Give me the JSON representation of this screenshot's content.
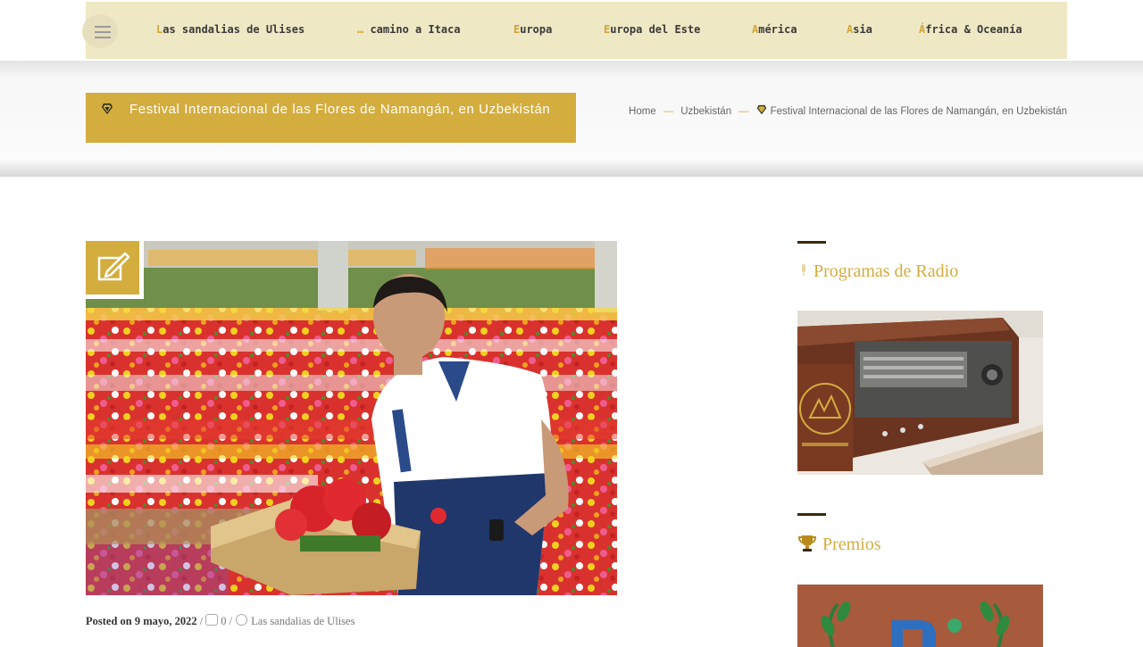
{
  "nav": {
    "items": [
      {
        "first": "L",
        "rest": "as sandalias de Ulises"
      },
      {
        "first": "…",
        "rest": " camino a Itaca"
      },
      {
        "first": "E",
        "rest": "uropa"
      },
      {
        "first": "E",
        "rest": "uropa del Este"
      },
      {
        "first": "A",
        "rest": "mérica"
      },
      {
        "first": "A",
        "rest": "sia"
      },
      {
        "first": "Á",
        "rest": "frica & Oceanía"
      }
    ]
  },
  "page_title": "Festival Internacional de las Flores de Namangán, en Uzbekistán",
  "breadcrumb": {
    "home": "Home",
    "separator": "—",
    "country": "Uzbekistán",
    "current": "Festival Internacional de las Flores de Namangán, en Uzbekistán"
  },
  "post_meta": {
    "posted_on_label": "Posted on",
    "date": "9 mayo, 2022",
    "sep": "/",
    "comments": "0",
    "author": "Las sandalias de Ulises"
  },
  "sidebar": {
    "radio_title": "Programas de Radio",
    "awards_title": "Premios"
  },
  "colors": {
    "accent": "#d4ad3f",
    "nav_bg": "#efe8c4"
  },
  "icons": [
    "menu-icon",
    "gem-icon",
    "edit-icon",
    "comment-icon",
    "user-icon",
    "microphone-icon",
    "trophy-icon"
  ]
}
